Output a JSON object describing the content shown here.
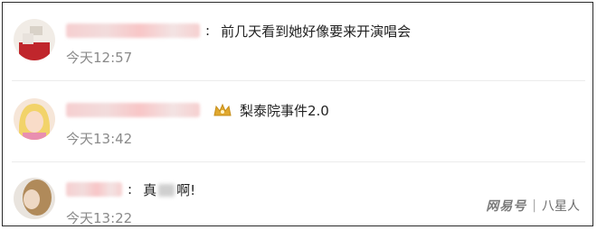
{
  "comments": [
    {
      "text": "前几天看到她好像要来开演唱会",
      "time": "今天12:57"
    },
    {
      "text": "梨泰院事件2.0",
      "time": "今天13:42",
      "badge": "crown-icon"
    },
    {
      "text_before": "真",
      "text_after": "啊!",
      "time": "今天13:22"
    }
  ],
  "watermark": {
    "logo": "网易号",
    "source": "八星人"
  },
  "colors": {
    "text": "#222222",
    "time": "#8a8a8a",
    "border": "#2a2a2a",
    "crown": "#e0a82e"
  }
}
